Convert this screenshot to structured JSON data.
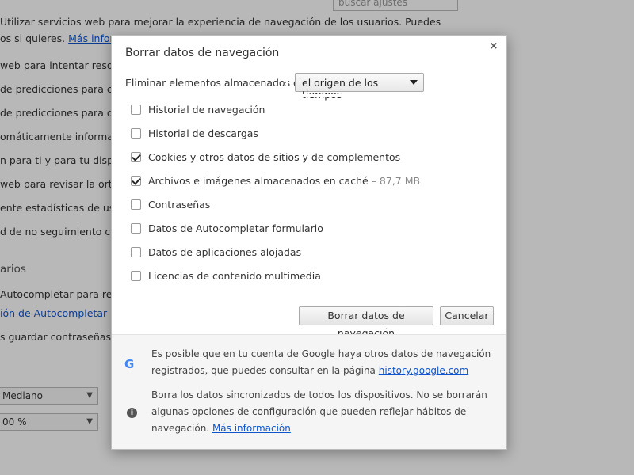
{
  "background": {
    "search_input_text": "buscar ajustes",
    "lines": [
      {
        "text": "Utilizar servicios web para mejorar la experiencia de navegación de los usuarios. Puedes"
      },
      {
        "text": "os si quieres.",
        "link": "Más informa"
      },
      {
        "text": "web para intentar resolve"
      },
      {
        "text": "de predicciones para com"
      },
      {
        "text": "de predicciones para que"
      },
      {
        "text": "omáticamente informació"
      },
      {
        "text": "n para ti y para tu disposit"
      },
      {
        "text": "web para revisar la ortogr"
      },
      {
        "text": "ente estadísticas de uso e"
      },
      {
        "text": "d de no seguimiento con t"
      }
    ],
    "section_heading": "arios",
    "autofill_lines": [
      "Autocompletar para relle",
      "ión de Autocompletar"
    ],
    "password_line": "s guardar contraseñas con",
    "font_select": "Mediano",
    "zoom_select": "00 %"
  },
  "dialog": {
    "title": "Borrar datos de navegación",
    "close_glyph": "×",
    "time_range_label": "Eliminar elementos almacenados desde:",
    "time_range_value": "el origen de los tiempos",
    "options": [
      {
        "label": "Historial de navegación",
        "checked": false,
        "size": ""
      },
      {
        "label": "Historial de descargas",
        "checked": false,
        "size": ""
      },
      {
        "label": "Cookies y otros datos de sitios y de complementos",
        "checked": true,
        "size": ""
      },
      {
        "label": "Archivos e imágenes almacenados en caché",
        "checked": true,
        "size": "–  87,7 MB"
      },
      {
        "label": "Contraseñas",
        "checked": false,
        "size": ""
      },
      {
        "label": "Datos de Autocompletar formulario",
        "checked": false,
        "size": ""
      },
      {
        "label": "Datos de aplicaciones alojadas",
        "checked": false,
        "size": ""
      },
      {
        "label": "Licencias de contenido multimedia",
        "checked": false,
        "size": ""
      }
    ],
    "clear_button": "Borrar datos de navegación",
    "cancel_button": "Cancelar",
    "footer": {
      "google_icon": "G",
      "info_icon": "i",
      "google_text": "Es posible que en tu cuenta de Google haya otros datos de navegación registrados, que puedes consultar en la página",
      "google_link": "history.google.com",
      "sync_text": "Borra los datos sincronizados de todos los dispositivos. No se borrarán algunas opciones de configuración que pueden reflejar hábitos de navegación.",
      "sync_link": "Más información"
    }
  },
  "colors": {
    "link": "#1155cc",
    "highlight": "#ffffff",
    "overlay": "rgba(0,0,0,0.28)"
  }
}
